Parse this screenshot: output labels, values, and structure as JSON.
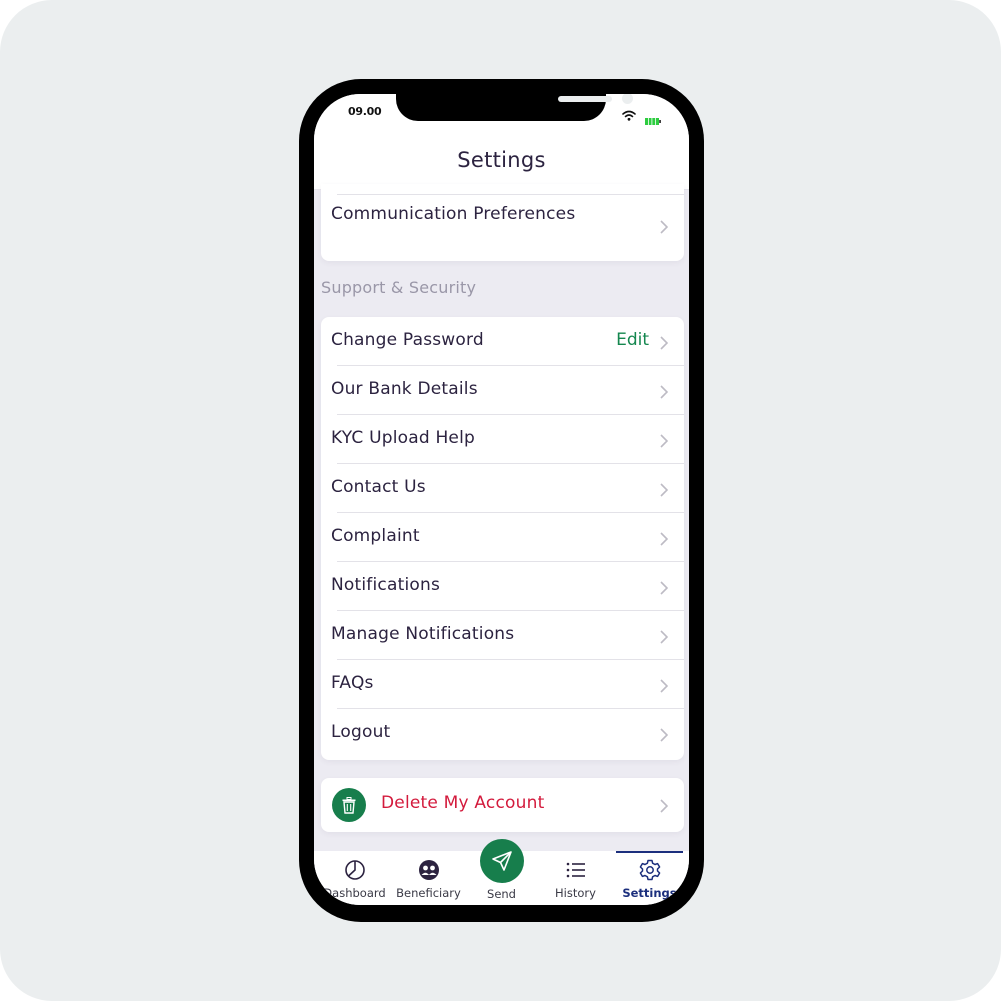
{
  "status_bar": {
    "time": "09.00",
    "wifi_icon": "wifi-icon",
    "battery_icon": "battery-icon",
    "battery_color": "#2ecc40"
  },
  "header": {
    "title": "Settings"
  },
  "top_card": {
    "items": [
      {
        "label": "Communication Preferences",
        "icon": "chevron-right-icon"
      }
    ]
  },
  "support_section": {
    "label": "Support & Security",
    "items": [
      {
        "label": "Change Password",
        "action": "Edit",
        "icon": "chevron-right-icon"
      },
      {
        "label": "Our Bank Details",
        "icon": "chevron-right-icon"
      },
      {
        "label": "KYC Upload Help",
        "icon": "chevron-right-icon"
      },
      {
        "label": "Contact Us",
        "icon": "chevron-right-icon"
      },
      {
        "label": "Complaint",
        "icon": "chevron-right-icon"
      },
      {
        "label": "Notifications",
        "icon": "chevron-right-icon"
      },
      {
        "label": "Manage Notifications",
        "icon": "chevron-right-icon"
      },
      {
        "label": "FAQs",
        "icon": "chevron-right-icon"
      },
      {
        "label": "Logout",
        "icon": "chevron-right-icon"
      }
    ]
  },
  "delete_account": {
    "label": "Delete My Account",
    "icon": "trash-icon",
    "color": "#d31a3c",
    "icon_bg": "#177e4c"
  },
  "tab_bar": {
    "active": "Settings",
    "tabs": [
      {
        "label": "Dashboard",
        "icon": "pie-chart-icon"
      },
      {
        "label": "Beneficiary",
        "icon": "users-icon"
      },
      {
        "label": "Send",
        "icon": "send-icon"
      },
      {
        "label": "History",
        "icon": "list-icon"
      },
      {
        "label": "Settings",
        "icon": "gear-icon"
      }
    ]
  },
  "colors": {
    "accent_green": "#177e4c",
    "active_tab": "#1c2f7d",
    "text_primary": "#2c2340",
    "section_label": "#9a97a8",
    "danger": "#d31a3c"
  }
}
